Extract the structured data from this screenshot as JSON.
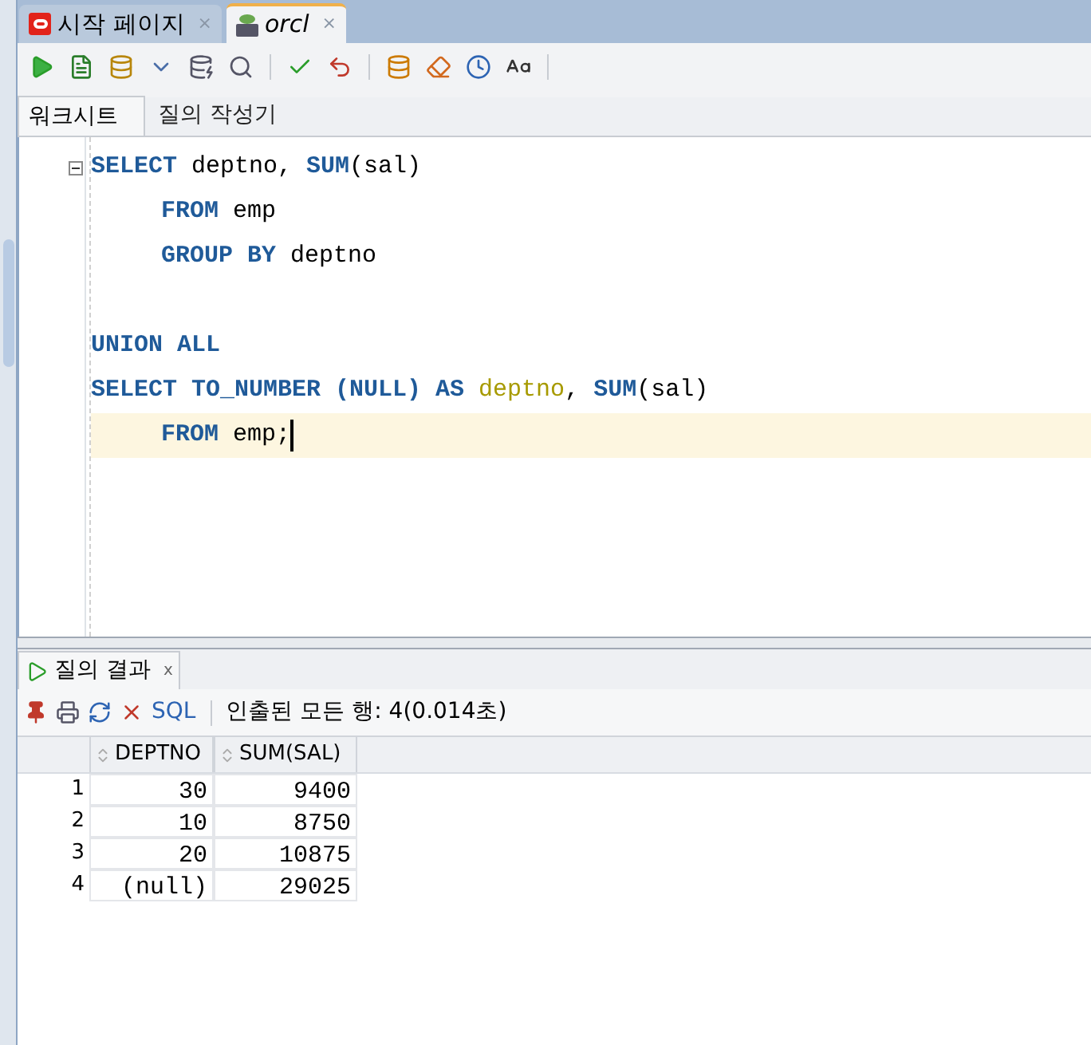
{
  "tabs": [
    {
      "label": "시작 페이지",
      "close": "×",
      "selected": false,
      "kind": "start"
    },
    {
      "label": "orcl",
      "close": "×",
      "selected": true,
      "kind": "sql"
    }
  ],
  "editor_tabs": [
    {
      "label": "워크시트",
      "selected": true
    },
    {
      "label": "질의 작성기",
      "selected": false
    }
  ],
  "code_lines": [
    {
      "current": false,
      "indent": false,
      "fold": true,
      "tokens": [
        {
          "text": "SELECT",
          "kind": "keyword"
        },
        {
          "text": " deptno, ",
          "kind": "plain"
        },
        {
          "text": "SUM",
          "kind": "keyword"
        },
        {
          "text": "(sal)",
          "kind": "plain"
        }
      ]
    },
    {
      "current": false,
      "indent": true,
      "tokens": [
        {
          "text": "FROM",
          "kind": "keyword"
        },
        {
          "text": " emp",
          "kind": "plain"
        }
      ]
    },
    {
      "current": false,
      "indent": true,
      "tokens": [
        {
          "text": "GROUP BY",
          "kind": "keyword"
        },
        {
          "text": " deptno",
          "kind": "plain"
        }
      ]
    },
    {
      "current": false
    },
    {
      "current": false,
      "indent": false,
      "tokens": [
        {
          "text": "UNION ALL",
          "kind": "keyword"
        }
      ]
    },
    {
      "current": false,
      "indent": false,
      "tokens": [
        {
          "text": "SELECT TO_NUMBER (NULL) AS",
          "kind": "keyword"
        },
        {
          "text": " deptno",
          "kind": "alias"
        },
        {
          "text": ", ",
          "kind": "plain"
        },
        {
          "text": "SUM",
          "kind": "keyword"
        },
        {
          "text": "(sal)",
          "kind": "plain"
        }
      ]
    },
    {
      "current": true,
      "indent": true,
      "tokens": [
        {
          "text": "FROM",
          "kind": "keyword"
        },
        {
          "text": " emp;",
          "kind": "plain"
        }
      ]
    }
  ],
  "result_tab": {
    "label": "질의 결과",
    "close": "x"
  },
  "result_toolbar": {
    "sql_link": "SQL",
    "status": "인출된 모든 행: 4(0.014초)"
  },
  "table": {
    "columns": [
      "DEPTNO",
      "SUM(SAL)"
    ],
    "rows": [
      {
        "num": "1",
        "cells": [
          "30",
          "9400"
        ]
      },
      {
        "num": "2",
        "cells": [
          "10",
          "8750"
        ]
      },
      {
        "num": "3",
        "cells": [
          "20",
          "10875"
        ]
      },
      {
        "num": "4",
        "cells": [
          "(null)",
          "29025"
        ]
      }
    ]
  }
}
